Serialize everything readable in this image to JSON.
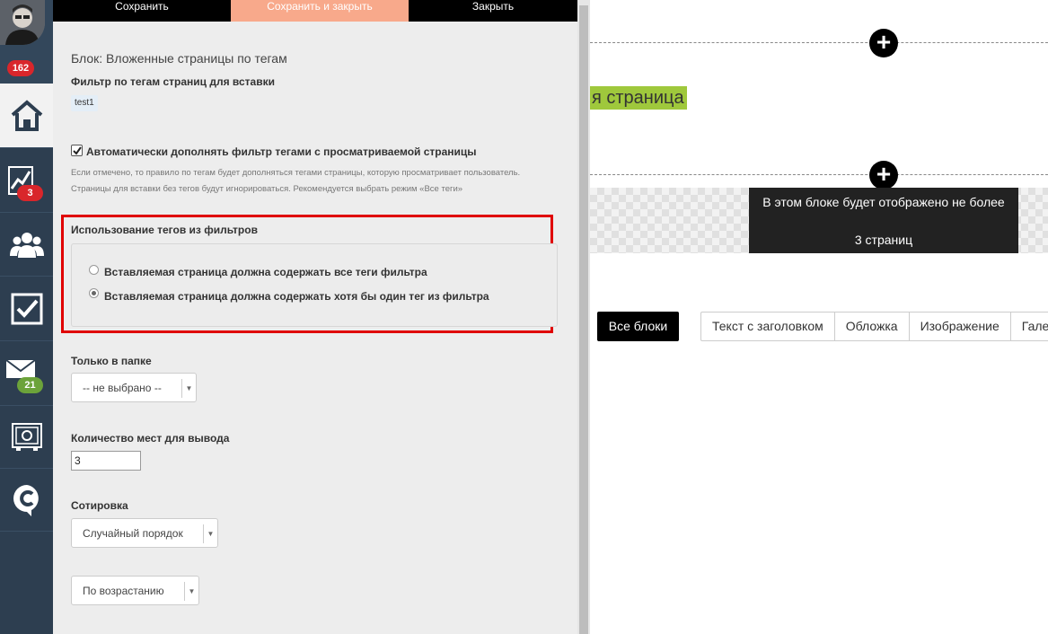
{
  "sidebar": {
    "badges": {
      "notifications": "162",
      "analytics": "3",
      "mail": "21"
    },
    "items": [
      {
        "name": "home-icon"
      },
      {
        "name": "chart-icon"
      },
      {
        "name": "users-icon"
      },
      {
        "name": "tasks-icon"
      },
      {
        "name": "mail-icon"
      },
      {
        "name": "safe-icon"
      },
      {
        "name": "logo-icon"
      }
    ]
  },
  "toolbar": {
    "save_label": "Сохранить",
    "save_close_label": "Сохранить и закрыть",
    "close_label": "Закрыть"
  },
  "editor": {
    "block_title": "Блок: Вложенные страницы по тегам",
    "tag_filter_label": "Фильтр по тегам страниц для вставки",
    "tag_chip": "test1",
    "auto_fill_label": "Автоматически дополнять фильтр тегами с просматриваемой страницы",
    "auto_fill_checked": true,
    "hint_line1": "Если отмечено, то правило по тегам будет дополняться тегами страницы, которую просматривает пользователь.",
    "hint_line2": "Страницы для вставки без тегов будут игнорироваться. Рекомендуется выбрать режим «Все теги»",
    "tag_usage_label": "Использование тегов из фильтров",
    "radio_all": "Вставляемая страница должна содержать все теги фильтра",
    "radio_any": "Вставляемая страница должна содержать хотя бы один тег из фильтра",
    "radio_selected": "any",
    "folder_label": "Только в папке",
    "folder_value": "-- не выбрано --",
    "count_label": "Количество мест для вывода",
    "count_value": "3",
    "sort_label": "Сотировка",
    "sort_value": "Случайный порядок",
    "order_value": "По возрастанию"
  },
  "preview": {
    "heading_fragment": "я страница",
    "notice_line1": "В этом блоке будет отображено не более",
    "notice_line2": "3 страниц",
    "all_blocks_label": "Все блоки",
    "filter_tabs": [
      "Текст с заголовком",
      "Обложка",
      "Изображение",
      "Галерея"
    ],
    "colors": {
      "accent": "#f8a98b",
      "highlight": "#9fc83c",
      "alert_border": "#e00000"
    }
  }
}
